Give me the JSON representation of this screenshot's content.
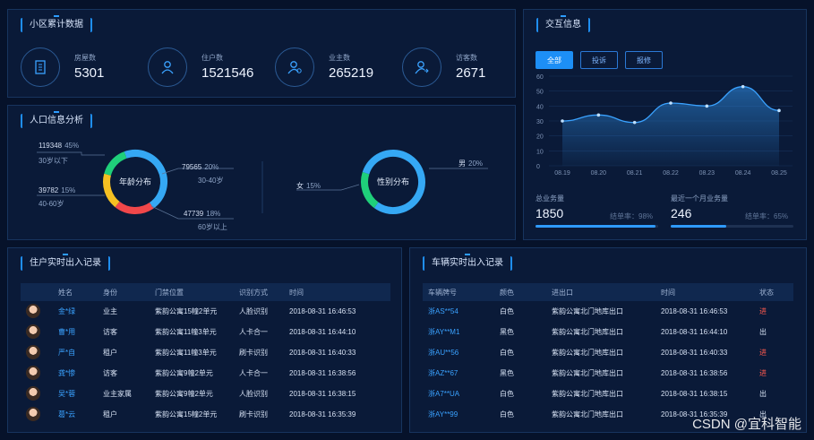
{
  "community": {
    "title": "小区累计数据",
    "stats": [
      {
        "label": "房屋数",
        "value": "5301",
        "icon": "building-icon"
      },
      {
        "label": "住户数",
        "value": "1521546",
        "icon": "user-icon"
      },
      {
        "label": "业主数",
        "value": "265219",
        "icon": "owner-icon"
      },
      {
        "label": "访客数",
        "value": "2671",
        "icon": "visitor-icon"
      }
    ]
  },
  "population": {
    "title": "人口信息分析",
    "age": {
      "center": "年龄分布",
      "segments": [
        {
          "value": "119348",
          "pct": "45%",
          "label": "30岁以下",
          "color": "#35a8f4",
          "fraction": 0.45
        },
        {
          "value": "79565",
          "pct": "20%",
          "label": "30-40岁",
          "color": "#f0474a",
          "fraction": 0.2
        },
        {
          "value": "47739",
          "pct": "18%",
          "label": "60岁以上",
          "color": "#f5c022",
          "fraction": 0.18
        },
        {
          "value": "39782",
          "pct": "15%",
          "label": "40-60岁",
          "color": "#1fcf7a",
          "fraction": 0.15
        }
      ]
    },
    "gender": {
      "center": "性别分布",
      "male": {
        "label": "男",
        "pct": "20%",
        "color": "#1fcf7a",
        "fraction": 0.2
      },
      "female": {
        "label": "女",
        "pct": "15%",
        "color": "#35a8f4",
        "fraction": 0.8
      }
    }
  },
  "interaction": {
    "title": "交互信息",
    "tabs": [
      "全部",
      "投诉",
      "报修"
    ],
    "chart_data": {
      "type": "area",
      "x": [
        "08.19",
        "08.20",
        "08.21",
        "08.22",
        "08.23",
        "08.24",
        "08.25"
      ],
      "values": [
        30,
        34,
        29,
        42,
        40,
        53,
        37
      ],
      "y_ticks": [
        "60",
        "50",
        "40",
        "30",
        "20",
        "10",
        "0"
      ],
      "ylim": [
        0,
        60
      ],
      "color": "#3aa2ff"
    },
    "total": {
      "label": "总业务量",
      "value": "1850",
      "rate_label": "结单率：",
      "rate": "98%",
      "fraction": 0.98
    },
    "month": {
      "label": "最近一个月业务量",
      "value": "246",
      "rate_label": "结单率：",
      "rate": "65%",
      "fraction": 0.45
    }
  },
  "residents": {
    "title": "住户实时出入记录",
    "headers": [
      "",
      "姓名",
      "身份",
      "门禁位置",
      "识别方式",
      "时间"
    ],
    "rows": [
      {
        "name": "金*绿",
        "role": "业主",
        "location": "紫韵公寓15幢2单元",
        "method": "人脸识别",
        "time": "2018-08-31 16:46:53"
      },
      {
        "name": "曹*用",
        "role": "访客",
        "location": "紫韵公寓11幢3单元",
        "method": "人卡合一",
        "time": "2018-08-31 16:44:10"
      },
      {
        "name": "严*自",
        "role": "租户",
        "location": "紫韵公寓11幢3单元",
        "method": "刷卡识别",
        "time": "2018-08-31 16:40:33"
      },
      {
        "name": "龚*惨",
        "role": "访客",
        "location": "紫韵公寓9幢2单元",
        "method": "人卡合一",
        "time": "2018-08-31 16:38:56"
      },
      {
        "name": "吴*蓉",
        "role": "业主家属",
        "location": "紫韵公寓9幢2单元",
        "method": "人脸识别",
        "time": "2018-08-31 16:38:15"
      },
      {
        "name": "葛*云",
        "role": "租户",
        "location": "紫韵公寓15幢2单元",
        "method": "刷卡识别",
        "time": "2018-08-31 16:35:39"
      }
    ]
  },
  "vehicles": {
    "title": "车辆实时出入记录",
    "headers": [
      "车辆牌号",
      "颜色",
      "进出口",
      "时间",
      "状态"
    ],
    "rows": [
      {
        "plate": "浙AS**54",
        "color": "白色",
        "gate": "紫韵公寓北门地库出口",
        "time": "2018-08-31 16:46:53",
        "status": "进",
        "in": true
      },
      {
        "plate": "浙AY**M1",
        "color": "黑色",
        "gate": "紫韵公寓北门地库出口",
        "time": "2018-08-31 16:44:10",
        "status": "出",
        "in": false
      },
      {
        "plate": "浙AU**56",
        "color": "白色",
        "gate": "紫韵公寓北门地库出口",
        "time": "2018-08-31 16:40:33",
        "status": "进",
        "in": true
      },
      {
        "plate": "浙AZ**67",
        "color": "黑色",
        "gate": "紫韵公寓北门地库出口",
        "time": "2018-08-31 16:38:56",
        "status": "进",
        "in": true
      },
      {
        "plate": "浙A7**UA",
        "color": "白色",
        "gate": "紫韵公寓北门地库出口",
        "time": "2018-08-31 16:38:15",
        "status": "出",
        "in": false
      },
      {
        "plate": "浙AY**99",
        "color": "白色",
        "gate": "紫韵公寓北门地库出口",
        "time": "2018-08-31 16:35:39",
        "status": "出",
        "in": false
      }
    ]
  },
  "watermark": "CSDN @宜科智能"
}
